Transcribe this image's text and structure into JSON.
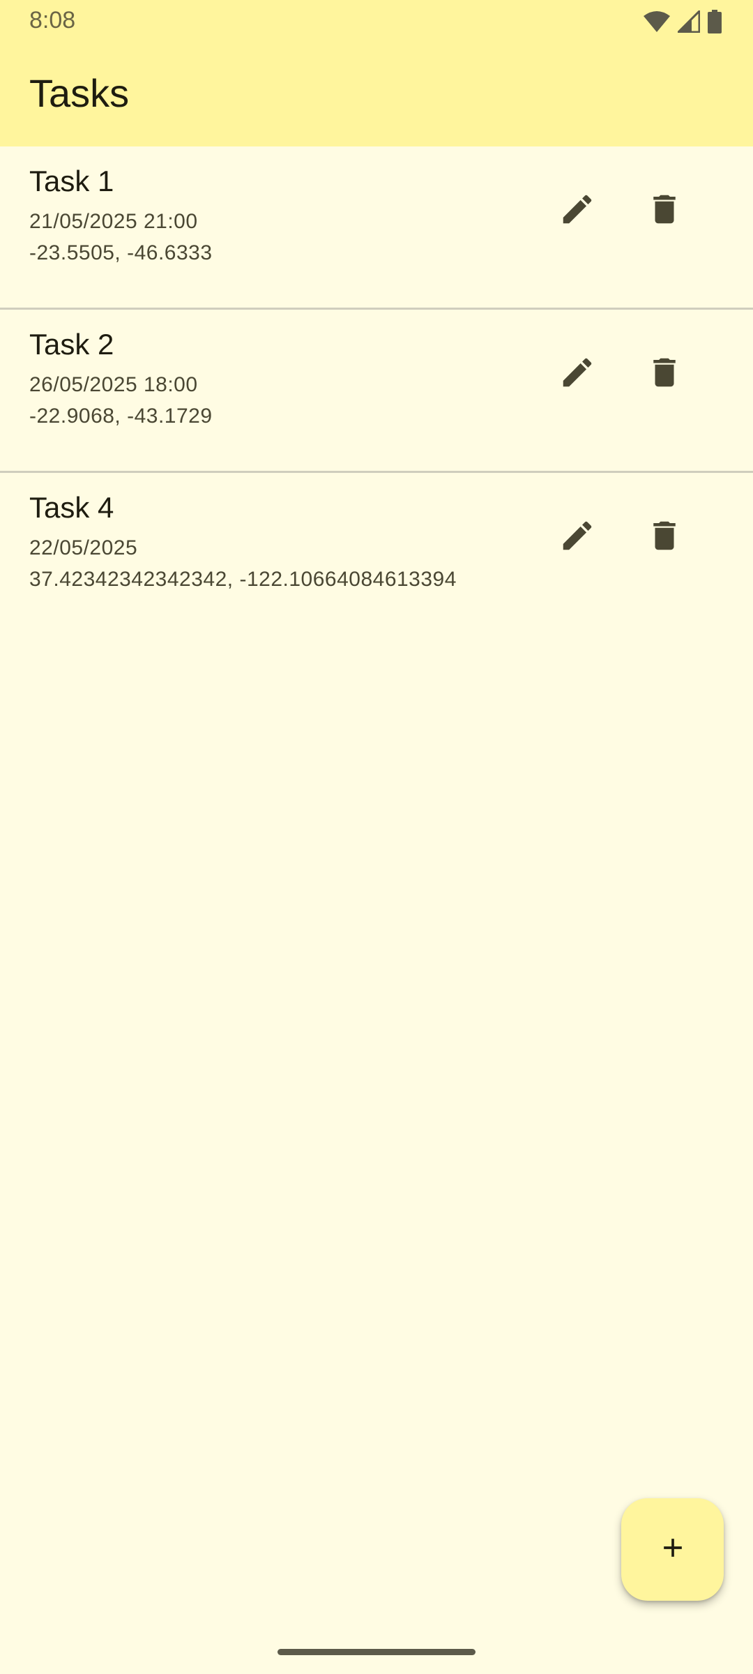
{
  "status_bar": {
    "time": "8:08",
    "icons": [
      "wifi-icon",
      "cell-signal-icon",
      "battery-icon"
    ]
  },
  "app_bar": {
    "title": "Tasks"
  },
  "tasks": [
    {
      "title": "Task 1",
      "date": "21/05/2025 21:00",
      "coords": "-23.5505, -46.6333"
    },
    {
      "title": "Task 2",
      "date": "26/05/2025 18:00",
      "coords": "-22.9068, -43.1729"
    },
    {
      "title": "Task 4",
      "date": "22/05/2025",
      "coords": "37.42342342342342, -122.10664084613394"
    }
  ],
  "row_actions": {
    "edit_icon": "pencil-icon",
    "delete_icon": "trash-icon"
  },
  "fab": {
    "icon": "plus-icon"
  },
  "colors": {
    "app_bar_bg": "#FFF59D",
    "page_bg": "#FFFCE3",
    "icon": "#4a4733"
  }
}
